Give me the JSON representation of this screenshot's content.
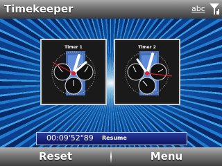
{
  "app": {
    "title": "Timekeeper",
    "input_mode": "abc"
  },
  "status_icons": [
    "signal-strength-icon"
  ],
  "timers": [
    {
      "label": "Timer 1"
    },
    {
      "label": "Timer 2"
    }
  ],
  "status_bar": {
    "elapsed": "00:09'52\"89",
    "action_label": "Resume"
  },
  "softkeys": {
    "left": "Reset",
    "right": "Menu"
  },
  "colors": {
    "accent_blue": "#1f7ad0",
    "hand_red": "#e0202a",
    "hand_white": "#ffffff",
    "status_bar": "#1b2480"
  }
}
